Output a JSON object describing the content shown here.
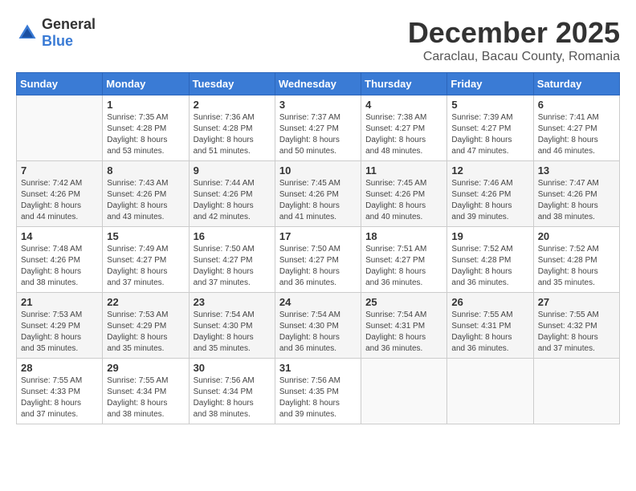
{
  "header": {
    "logo_general": "General",
    "logo_blue": "Blue",
    "month_title": "December 2025",
    "location": "Caraclau, Bacau County, Romania"
  },
  "days_of_week": [
    "Sunday",
    "Monday",
    "Tuesday",
    "Wednesday",
    "Thursday",
    "Friday",
    "Saturday"
  ],
  "weeks": [
    [
      {
        "day": "",
        "info": ""
      },
      {
        "day": "1",
        "info": "Sunrise: 7:35 AM\nSunset: 4:28 PM\nDaylight: 8 hours\nand 53 minutes."
      },
      {
        "day": "2",
        "info": "Sunrise: 7:36 AM\nSunset: 4:28 PM\nDaylight: 8 hours\nand 51 minutes."
      },
      {
        "day": "3",
        "info": "Sunrise: 7:37 AM\nSunset: 4:27 PM\nDaylight: 8 hours\nand 50 minutes."
      },
      {
        "day": "4",
        "info": "Sunrise: 7:38 AM\nSunset: 4:27 PM\nDaylight: 8 hours\nand 48 minutes."
      },
      {
        "day": "5",
        "info": "Sunrise: 7:39 AM\nSunset: 4:27 PM\nDaylight: 8 hours\nand 47 minutes."
      },
      {
        "day": "6",
        "info": "Sunrise: 7:41 AM\nSunset: 4:27 PM\nDaylight: 8 hours\nand 46 minutes."
      }
    ],
    [
      {
        "day": "7",
        "info": "Sunrise: 7:42 AM\nSunset: 4:26 PM\nDaylight: 8 hours\nand 44 minutes."
      },
      {
        "day": "8",
        "info": "Sunrise: 7:43 AM\nSunset: 4:26 PM\nDaylight: 8 hours\nand 43 minutes."
      },
      {
        "day": "9",
        "info": "Sunrise: 7:44 AM\nSunset: 4:26 PM\nDaylight: 8 hours\nand 42 minutes."
      },
      {
        "day": "10",
        "info": "Sunrise: 7:45 AM\nSunset: 4:26 PM\nDaylight: 8 hours\nand 41 minutes."
      },
      {
        "day": "11",
        "info": "Sunrise: 7:45 AM\nSunset: 4:26 PM\nDaylight: 8 hours\nand 40 minutes."
      },
      {
        "day": "12",
        "info": "Sunrise: 7:46 AM\nSunset: 4:26 PM\nDaylight: 8 hours\nand 39 minutes."
      },
      {
        "day": "13",
        "info": "Sunrise: 7:47 AM\nSunset: 4:26 PM\nDaylight: 8 hours\nand 38 minutes."
      }
    ],
    [
      {
        "day": "14",
        "info": "Sunrise: 7:48 AM\nSunset: 4:26 PM\nDaylight: 8 hours\nand 38 minutes."
      },
      {
        "day": "15",
        "info": "Sunrise: 7:49 AM\nSunset: 4:27 PM\nDaylight: 8 hours\nand 37 minutes."
      },
      {
        "day": "16",
        "info": "Sunrise: 7:50 AM\nSunset: 4:27 PM\nDaylight: 8 hours\nand 37 minutes."
      },
      {
        "day": "17",
        "info": "Sunrise: 7:50 AM\nSunset: 4:27 PM\nDaylight: 8 hours\nand 36 minutes."
      },
      {
        "day": "18",
        "info": "Sunrise: 7:51 AM\nSunset: 4:27 PM\nDaylight: 8 hours\nand 36 minutes."
      },
      {
        "day": "19",
        "info": "Sunrise: 7:52 AM\nSunset: 4:28 PM\nDaylight: 8 hours\nand 36 minutes."
      },
      {
        "day": "20",
        "info": "Sunrise: 7:52 AM\nSunset: 4:28 PM\nDaylight: 8 hours\nand 35 minutes."
      }
    ],
    [
      {
        "day": "21",
        "info": "Sunrise: 7:53 AM\nSunset: 4:29 PM\nDaylight: 8 hours\nand 35 minutes."
      },
      {
        "day": "22",
        "info": "Sunrise: 7:53 AM\nSunset: 4:29 PM\nDaylight: 8 hours\nand 35 minutes."
      },
      {
        "day": "23",
        "info": "Sunrise: 7:54 AM\nSunset: 4:30 PM\nDaylight: 8 hours\nand 35 minutes."
      },
      {
        "day": "24",
        "info": "Sunrise: 7:54 AM\nSunset: 4:30 PM\nDaylight: 8 hours\nand 36 minutes."
      },
      {
        "day": "25",
        "info": "Sunrise: 7:54 AM\nSunset: 4:31 PM\nDaylight: 8 hours\nand 36 minutes."
      },
      {
        "day": "26",
        "info": "Sunrise: 7:55 AM\nSunset: 4:31 PM\nDaylight: 8 hours\nand 36 minutes."
      },
      {
        "day": "27",
        "info": "Sunrise: 7:55 AM\nSunset: 4:32 PM\nDaylight: 8 hours\nand 37 minutes."
      }
    ],
    [
      {
        "day": "28",
        "info": "Sunrise: 7:55 AM\nSunset: 4:33 PM\nDaylight: 8 hours\nand 37 minutes."
      },
      {
        "day": "29",
        "info": "Sunrise: 7:55 AM\nSunset: 4:34 PM\nDaylight: 8 hours\nand 38 minutes."
      },
      {
        "day": "30",
        "info": "Sunrise: 7:56 AM\nSunset: 4:34 PM\nDaylight: 8 hours\nand 38 minutes."
      },
      {
        "day": "31",
        "info": "Sunrise: 7:56 AM\nSunset: 4:35 PM\nDaylight: 8 hours\nand 39 minutes."
      },
      {
        "day": "",
        "info": ""
      },
      {
        "day": "",
        "info": ""
      },
      {
        "day": "",
        "info": ""
      }
    ]
  ]
}
